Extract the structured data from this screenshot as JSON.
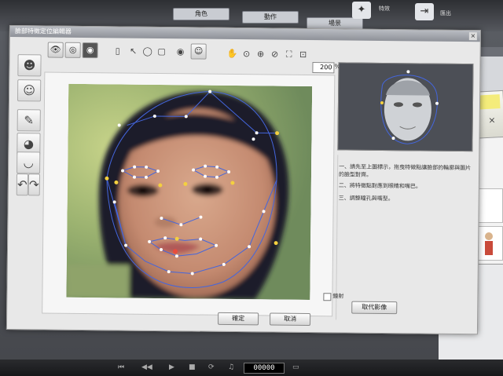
{
  "app_bar": {
    "tabs": [
      "角色",
      "動作",
      "場景"
    ],
    "buttons": [
      {
        "icon": "sparkle-icon",
        "label": "特效"
      },
      {
        "icon": "exit-icon",
        "label": "匯出"
      }
    ]
  },
  "dialog": {
    "title": "臉部特徵定位編輯器",
    "close_glyph": "×",
    "zoom": {
      "value": "200",
      "unit": "%"
    },
    "instructions": [
      "一、請先至上圖標示，拖曳特徵點讓臉部的輪廓與圖片的臉型對齊。",
      "二、將特徵點對應到眼睛和嘴巴。",
      "三、調整瞳孔與嘴型。"
    ],
    "checkbox_label": "鏡射",
    "buttons": {
      "ok": "確定",
      "cancel": "取消",
      "reset": "取代影像"
    }
  },
  "timeline": {
    "timecode": "00000"
  },
  "colors": {
    "mesh_line": "#4466dd",
    "mesh_point": "#ffffff",
    "mesh_point_active": "#f4d03f",
    "mesh_point_selected": "#e84c3d"
  }
}
